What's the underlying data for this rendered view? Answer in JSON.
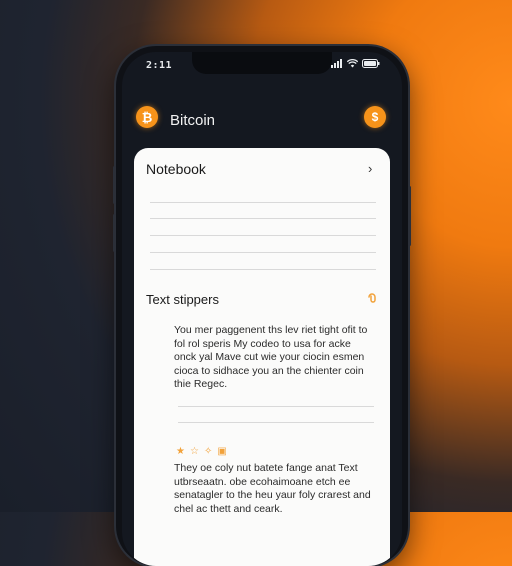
{
  "status": {
    "time": "2:11"
  },
  "header": {
    "title": "Bitcoin",
    "left_icon": "bitcoin-icon",
    "right_icon": "dollar-coin-icon"
  },
  "notebook": {
    "title": "Notebook"
  },
  "snippets": {
    "title": "Text stippers",
    "paragraph1": "You mer paggenent ths lev riet tight ofit to fol rol speris My codeo to usa for acke onck yal Mave cut wie your ciocin esmen cioca to sidhace you an the chienter coin thie Regec.",
    "paragraph2": "They oe coly nut batete fange anat Text utbrseaatn. obe ecohaimoane etch ee senatagler to the heu yaur foly crarest and chel ac thett and ceark."
  },
  "colors": {
    "accent": "#f7931a"
  }
}
